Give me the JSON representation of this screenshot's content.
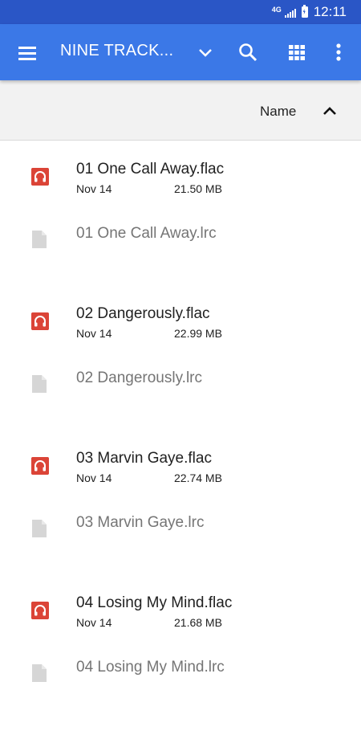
{
  "status_bar": {
    "network": "4G",
    "time": "12:11"
  },
  "app_bar": {
    "menu_icon": "hamburger-menu-icon",
    "title": "NINE TRACK...",
    "dropdown_icon": "chevron-down-icon",
    "search_icon": "search-icon",
    "grid_icon": "grid-view-icon",
    "more_icon": "more-vert-icon"
  },
  "sort_bar": {
    "label": "Name",
    "direction_icon": "chevron-up-icon"
  },
  "files": [
    {
      "name": "01 One Call Away.flac",
      "date": "Nov 14",
      "size": "21.50 MB",
      "type": "audio",
      "icon": "headphones-icon"
    },
    {
      "name": "01 One Call Away.lrc",
      "type": "document",
      "icon": "file-icon"
    },
    {
      "name": "02 Dangerously.flac",
      "date": "Nov 14",
      "size": "22.99 MB",
      "type": "audio",
      "icon": "headphones-icon"
    },
    {
      "name": "02 Dangerously.lrc",
      "type": "document",
      "icon": "file-icon"
    },
    {
      "name": "03 Marvin Gaye.flac",
      "date": "Nov 14",
      "size": "22.74 MB",
      "type": "audio",
      "icon": "headphones-icon"
    },
    {
      "name": "03 Marvin Gaye.lrc",
      "type": "document",
      "icon": "file-icon"
    },
    {
      "name": "04 Losing My Mind.flac",
      "date": "Nov 14",
      "size": "21.68 MB",
      "type": "audio",
      "icon": "headphones-icon"
    },
    {
      "name": "04 Losing My Mind.lrc",
      "type": "document",
      "icon": "file-icon"
    }
  ],
  "colors": {
    "status_bar": "#2a56c6",
    "app_bar": "#3b78e7",
    "audio_icon": "#db4437",
    "doc_icon": "#d6d6d6"
  }
}
